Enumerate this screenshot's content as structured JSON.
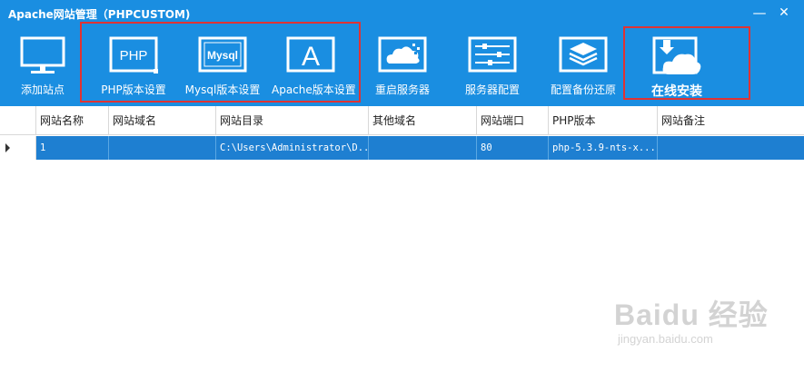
{
  "window": {
    "title": "Apache网站管理（PHPCUSTOM)",
    "minimize_glyph": "—",
    "close_glyph": "✕"
  },
  "toolbar": {
    "items": [
      {
        "label": "添加站点",
        "icon": "monitor-icon"
      },
      {
        "label": "PHP版本设置",
        "icon": "php-icon",
        "icon_text": "PHP"
      },
      {
        "label": "Mysql版本设置",
        "icon": "mysql-icon",
        "icon_text": "Mysql"
      },
      {
        "label": "Apache版本设置",
        "icon": "apache-icon",
        "icon_text": "A"
      },
      {
        "label": "重启服务器",
        "icon": "cloud-server-icon"
      },
      {
        "label": "服务器配置",
        "icon": "sliders-icon"
      },
      {
        "label": "配置备份还原",
        "icon": "layers-icon"
      },
      {
        "label": "在线安装",
        "icon": "cloud-download-icon"
      }
    ]
  },
  "grid": {
    "columns": [
      "网站名称",
      "网站域名",
      "网站目录",
      "其他域名",
      "网站端口",
      "PHP版本",
      "网站备注"
    ],
    "rows": [
      {
        "selected": true,
        "cells": [
          "1",
          "",
          "C:\\Users\\Administrator\\D...",
          "",
          "80",
          "php-5.3.9-nts-x...",
          ""
        ]
      }
    ]
  },
  "watermark": {
    "main": "Baidu 经验",
    "sub": "jingyan.baidu.com"
  },
  "colors": {
    "header_bg": "#1a8ee1",
    "selected_row": "#1e7fd1",
    "highlight_box": "#e03333"
  }
}
